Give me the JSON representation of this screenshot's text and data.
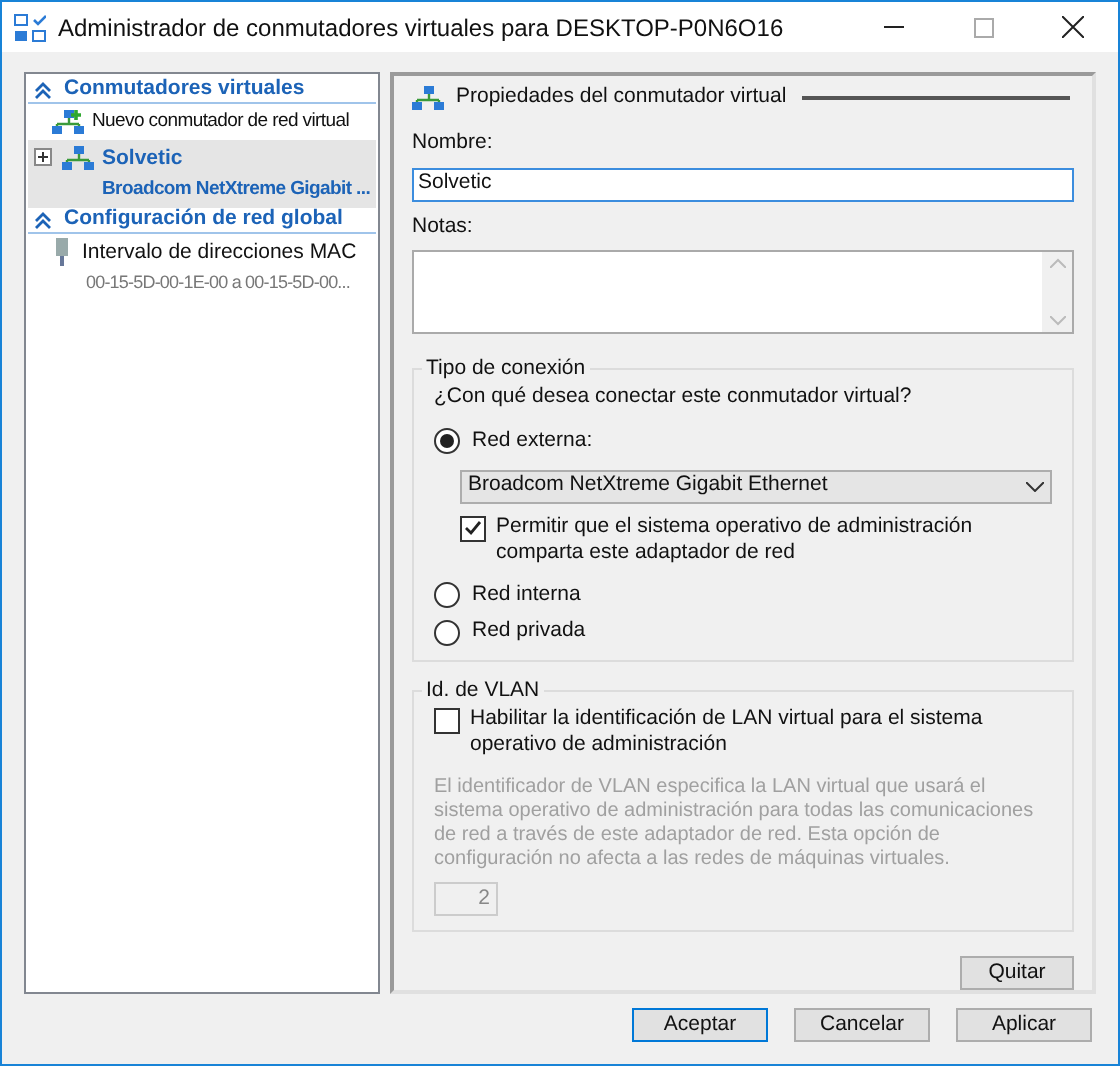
{
  "window": {
    "title": "Administrador de conmutadores virtuales para DESKTOP-P0N6O16"
  },
  "sidebar": {
    "sections": [
      {
        "title": "Conmutadores virtuales",
        "expanded": true,
        "items": [
          {
            "kind": "new",
            "label": "Nuevo conmutador de red virtual",
            "selected": false
          },
          {
            "kind": "switch",
            "label": "Solvetic",
            "sublabel": "Broadcom NetXtreme Gigabit ...",
            "selected": true,
            "expanded": false
          }
        ]
      },
      {
        "title": "Configuración de red global",
        "expanded": true,
        "items": [
          {
            "kind": "mac",
            "label": "Intervalo de direcciones MAC",
            "sublabel": "00-15-5D-00-1E-00 a 00-15-5D-00...",
            "selected": false
          }
        ]
      }
    ]
  },
  "properties": {
    "title": "Propiedades del conmutador virtual",
    "name_label": "Nombre:",
    "name_value": "Solvetic",
    "notes_label": "Notas:",
    "connection": {
      "title": "Tipo de conexión",
      "question": "¿Con qué desea conectar este conmutador virtual?",
      "options": [
        {
          "label": "Red externa:",
          "selected": true
        },
        {
          "label": "Red interna",
          "selected": false
        },
        {
          "label": "Red privada",
          "selected": false
        }
      ],
      "adapter": "Broadcom NetXtreme Gigabit Ethernet",
      "share": {
        "label": "Permitir que el sistema operativo de administración comparta este adaptador de red",
        "checked": true
      }
    },
    "vlan": {
      "title": "Id. de VLAN",
      "enable": {
        "label": "Habilitar la identificación de LAN virtual para el sistema operativo de administración",
        "checked": false
      },
      "description": "El identificador de VLAN especifica la LAN virtual que usará el sistema operativo de administración para todas las comunicaciones de red a través de este adaptador de red. Esta opción de configuración no afecta a las redes de máquinas virtuales.",
      "id_value": "2"
    },
    "remove_button": "Quitar"
  },
  "buttons": [
    {
      "label": "Aceptar",
      "default": true
    },
    {
      "label": "Cancelar",
      "default": false
    },
    {
      "label": "Aplicar",
      "default": false
    }
  ]
}
